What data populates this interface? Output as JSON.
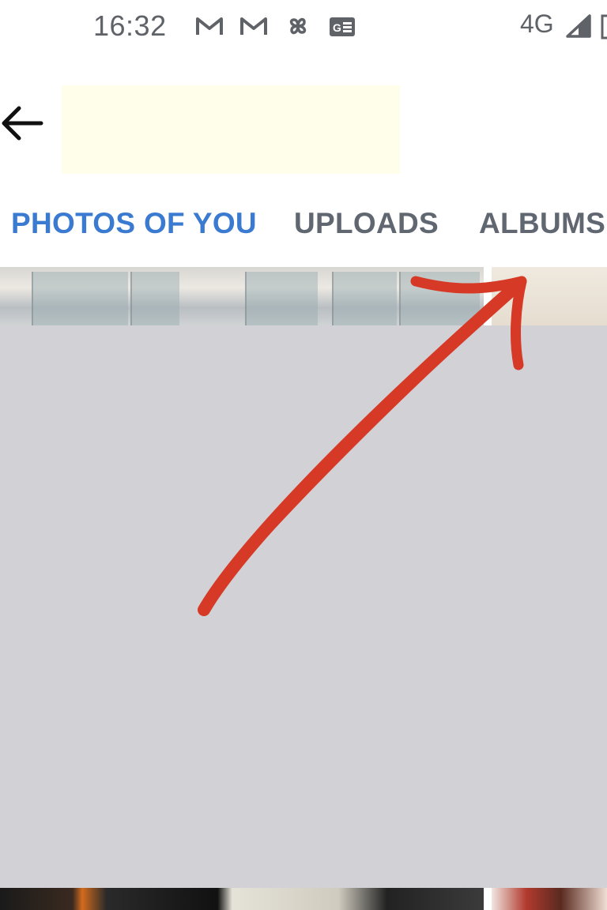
{
  "status_bar": {
    "time": "16:32",
    "notification_icons": [
      "gmail-icon",
      "gmail-icon",
      "pinwheel-icon",
      "news-icon"
    ],
    "network": "4G",
    "signal_icon": "signal-icon",
    "battery_icon": "battery-icon"
  },
  "app_bar": {
    "back_icon": "arrow-left-icon",
    "title_highlight_color": "#fefeeb"
  },
  "tabs": [
    {
      "label": "PHOTOS OF YOU",
      "active": true
    },
    {
      "label": "UPLOADS",
      "active": false
    },
    {
      "label": "ALBUMS",
      "active": false
    }
  ],
  "colors": {
    "active_tab": "#3a7ad0",
    "inactive_tab": "#606770",
    "placeholder_gray": "#d2d2d6",
    "annotation_arrow": "#d63a26"
  },
  "annotation": {
    "shape": "hand-drawn arrow",
    "points_to": "top-right photo"
  }
}
